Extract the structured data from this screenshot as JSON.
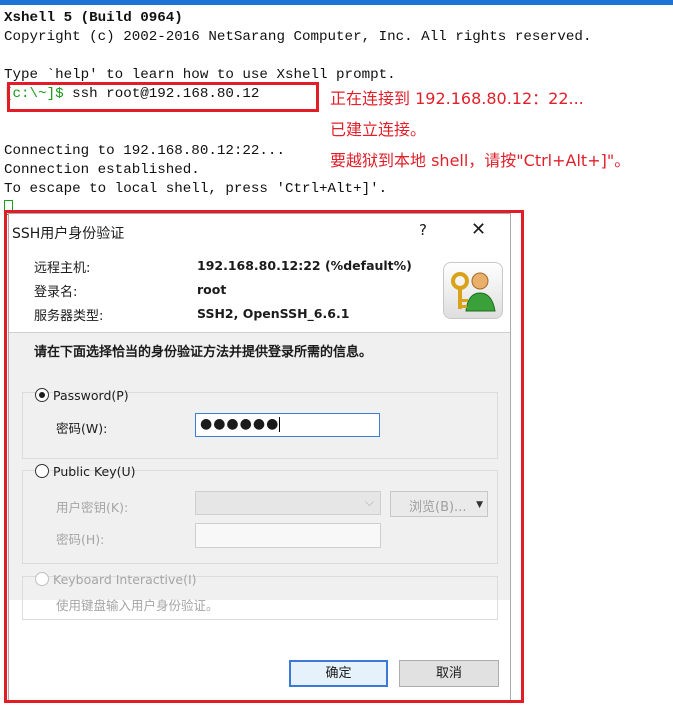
{
  "terminal": {
    "line1": "Xshell 5 (Build 0964)",
    "line2": "Copyright (c) 2002-2016 NetSarang Computer, Inc. All rights reserved.",
    "line3": "Type `help' to learn how to use Xshell prompt.",
    "prompt": "[c:\\~]$",
    "command": " ssh root@192.168.80.12",
    "line5": "Connecting to 192.168.80.12:22...",
    "line6": "Connection established.",
    "line7": "To escape to local shell, press 'Ctrl+Alt+]'."
  },
  "annotations": {
    "note1": "正在连接到 192.168.80.12：22...",
    "note2": "已建立连接。",
    "note3": "要越狱到本地 shell，请按\"Ctrl+Alt+]\"。"
  },
  "dialog": {
    "title": "SSH用户身份验证",
    "help": "?",
    "close": "✕",
    "remote_host_label": "远程主机:",
    "remote_host_value": "192.168.80.12:22 (%default%)",
    "login_label": "登录名:",
    "login_value": "root",
    "server_type_label": "服务器类型:",
    "server_type_value": "SSH2, OpenSSH_6.6.1",
    "instruction": "请在下面选择恰当的身份验证方法并提供登录所需的信息。",
    "password_option": "Password(P)",
    "password_field_label": "密码(W):",
    "password_value": "●●●●●●",
    "publickey_option": "Public Key(U)",
    "user_key_label": "用户密钥(K):",
    "browse_label": "浏览(B)...",
    "passphrase_label": "密码(H):",
    "keyboard_option": "Keyboard Interactive(I)",
    "keyboard_desc": "使用键盘输入用户身份验证。",
    "ok_label": "确定",
    "cancel_label": "取消"
  },
  "colors": {
    "annotation_red": "#e21d28",
    "prompt_green": "#1a9a1a",
    "focus_blue": "#3b78d8"
  }
}
